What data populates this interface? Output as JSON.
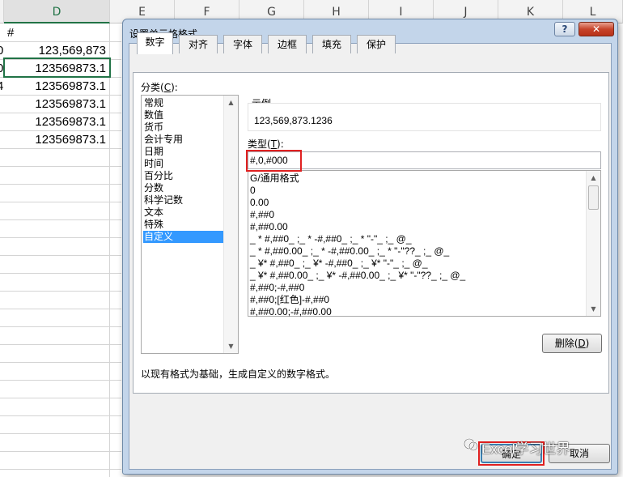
{
  "sheet": {
    "columns": [
      {
        "letter": "D"
      },
      {
        "letter": "E"
      },
      {
        "letter": "F"
      },
      {
        "letter": "G"
      },
      {
        "letter": "H"
      },
      {
        "letter": "I"
      },
      {
        "letter": "J"
      },
      {
        "letter": "K"
      },
      {
        "letter": "L"
      }
    ],
    "row_header_cell": "#",
    "col_c_fragments": [
      "0",
      "0",
      "4"
    ],
    "col_d_values": [
      "123,569,873",
      "123569873.1",
      "123569873.1",
      "123569873.1",
      "123569873.1",
      "123569873.1"
    ]
  },
  "dialog": {
    "title": "设置单元格格式",
    "help_label": "?",
    "close_label": "✕",
    "tabs": [
      "数字",
      "对齐",
      "字体",
      "边框",
      "填充",
      "保护"
    ],
    "active_tab": "数字",
    "category_label": "分类(",
    "category_label_key": "C",
    "category_label_end": "):",
    "categories": [
      "常规",
      "数值",
      "货币",
      "会计专用",
      "日期",
      "时间",
      "百分比",
      "分数",
      "科学记数",
      "文本",
      "特殊",
      "自定义"
    ],
    "selected_category": "自定义",
    "sample_label": "示例",
    "sample_value": "123,569,873.1236",
    "type_label": "类型(",
    "type_label_key": "T",
    "type_label_end": "):",
    "type_value": "#,0,#000",
    "formats": [
      "G/通用格式",
      "0",
      "0.00",
      "#,##0",
      "#,##0.00",
      "_ * #,##0_ ;_ * -#,##0_ ;_ * \"-\"_ ;_ @_",
      "_ * #,##0.00_ ;_ * -#,##0.00_ ;_ * \"-\"??_ ;_ @_",
      "_ ¥* #,##0_ ;_ ¥* -#,##0_ ;_ ¥* \"-\"_ ;_ @_",
      "_ ¥* #,##0.00_ ;_ ¥* -#,##0.00_ ;_ ¥* \"-\"??_ ;_ @_",
      "#,##0;-#,##0",
      "#,##0;[红色]-#,##0",
      "#,##0.00;-#,##0.00"
    ],
    "delete_label": "删除(",
    "delete_key": "D",
    "delete_end": ")",
    "description": "以现有格式为基础，生成自定义的数字格式。",
    "ok_label": "确定",
    "cancel_label": "取消"
  },
  "watermark": {
    "text": "Excel学习世界"
  },
  "colors": {
    "selected": "#3399ff",
    "highlight": "#e02020",
    "excel_green": "#217346"
  }
}
